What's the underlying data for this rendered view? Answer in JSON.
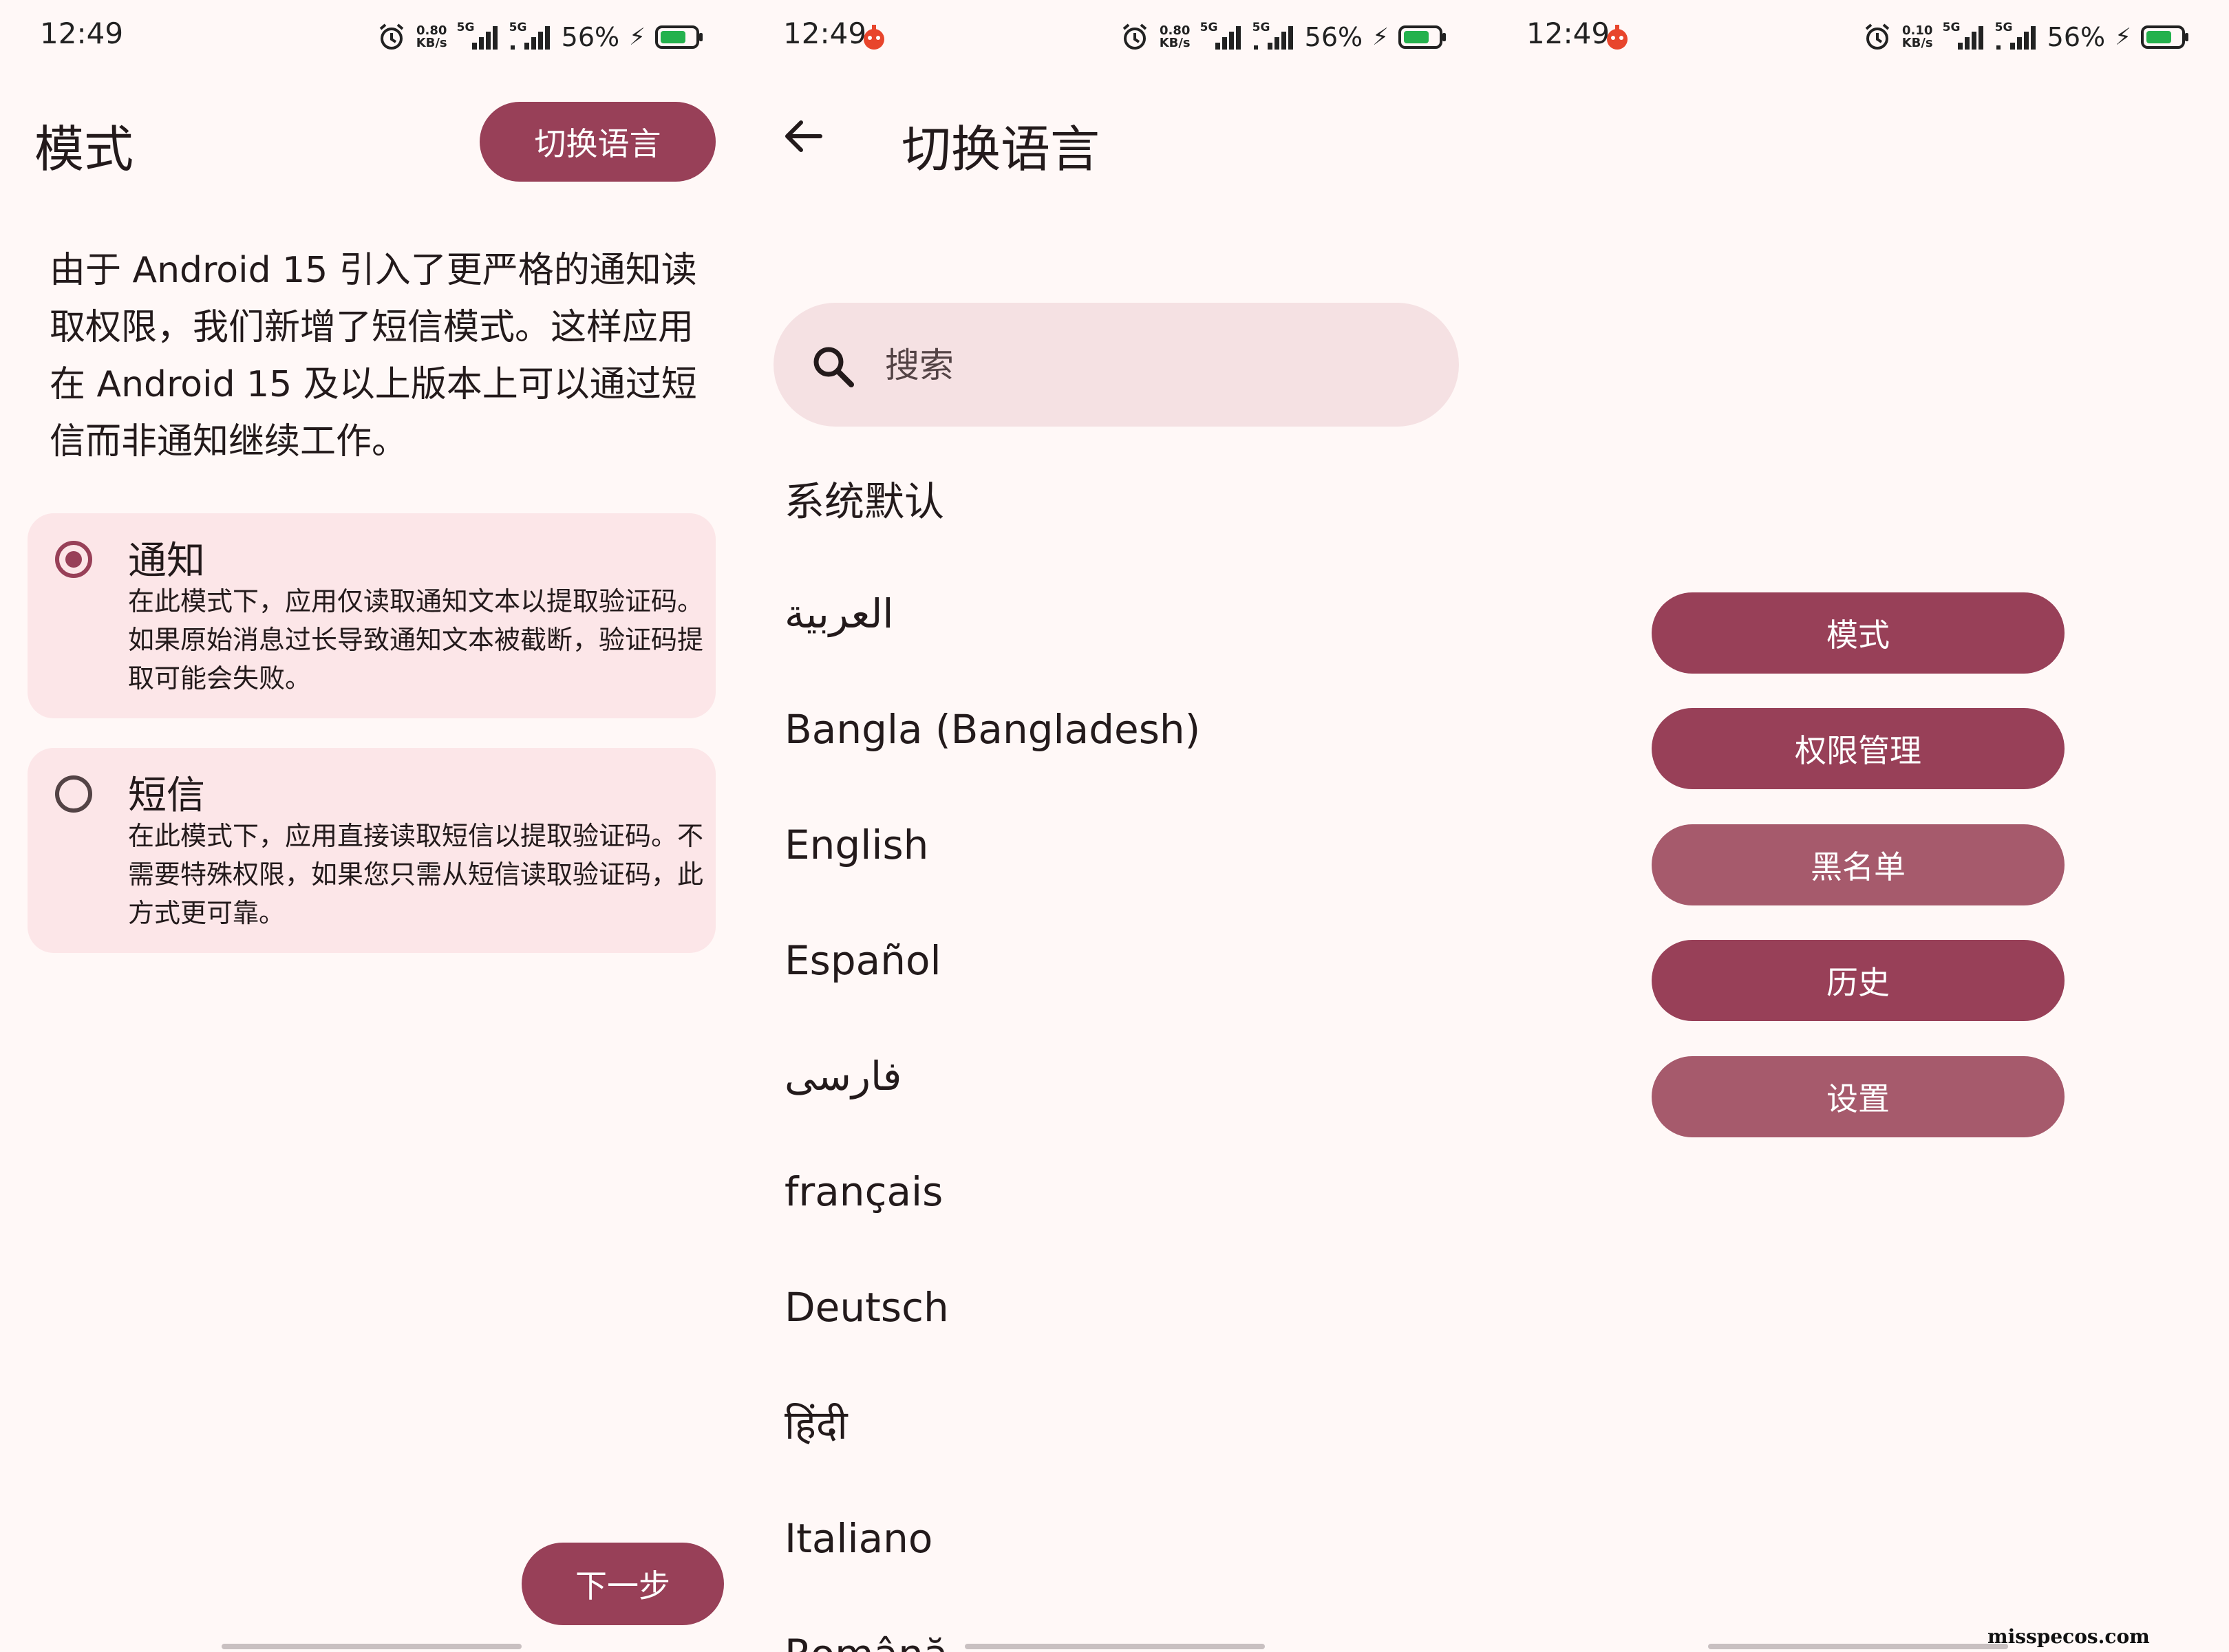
{
  "status": {
    "time": "12:49",
    "screens": [
      {
        "speed_value": "0.80",
        "speed_unit": "KB/s",
        "net1": "5G",
        "net2": "5G",
        "battery_pct": "56%"
      },
      {
        "speed_value": "0.80",
        "speed_unit": "KB/s",
        "net1": "5G",
        "net2": "5G",
        "battery_pct": "56%"
      },
      {
        "speed_value": "0.10",
        "speed_unit": "KB/s",
        "net1": "5G",
        "net2": "5G",
        "battery_pct": "56%"
      }
    ]
  },
  "colors": {
    "primary": "#984058",
    "card": "#FCE6E8",
    "search_bg": "#F5E1E3",
    "background": "#FFF8F7"
  },
  "mode_screen": {
    "title": "模式",
    "switch_language_label": "切换语言",
    "description": "由于 Android 15 引入了更严格的通知读取权限，我们新增了短信模式。这样应用在 Android 15 及以上版本上可以通过短信而非通知继续工作。",
    "options": [
      {
        "title": "通知",
        "description": "在此模式下，应用仅读取通知文本以提取验证码。如果原始消息过长导致通知文本被截断，验证码提取可能会失败。",
        "selected": true
      },
      {
        "title": "短信",
        "description": "在此模式下，应用直接读取短信以提取验证码。不需要特殊权限，如果您只需从短信读取验证码，此方式更可靠。",
        "selected": false
      }
    ],
    "next_label": "下一步"
  },
  "language_screen": {
    "title": "切换语言",
    "search_placeholder": "搜索",
    "languages": [
      "系统默认",
      "العربية",
      "Bangla (Bangladesh)",
      "English",
      "Español",
      "فارسی",
      "français",
      "Deutsch",
      "हिंदी",
      "Italiano",
      "Română"
    ]
  },
  "menu_screen": {
    "buttons": [
      "模式",
      "权限管理",
      "黑名单",
      "历史",
      "设置"
    ]
  },
  "watermark": "misspecos.com"
}
